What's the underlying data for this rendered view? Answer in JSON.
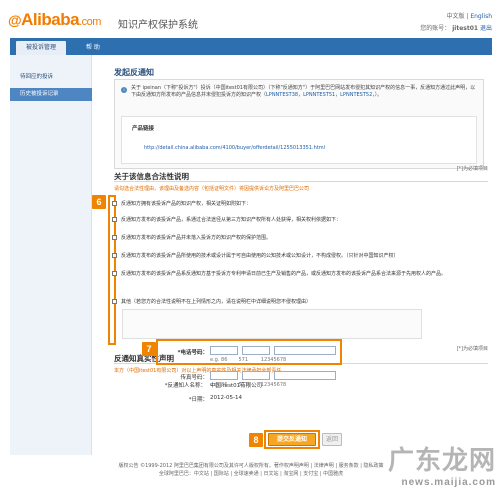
{
  "header": {
    "logo_text": "Alibaba",
    "logo_domain": ".com",
    "system_title": "知识产权保护系统",
    "lang_cn": "中文版",
    "lang_sep": "|",
    "lang_en": "English",
    "account_label": "您的账号：",
    "account_value": "jitest01",
    "logout": "退出"
  },
  "nav": {
    "tab_active": "被投诉管理",
    "tab_help": "帮 助"
  },
  "sidebar": {
    "items": [
      {
        "label": "待回应的投诉"
      },
      {
        "label": "历史被投诉记录"
      }
    ]
  },
  "page": {
    "title": "发起反通知",
    "notice_text": "关于 ipeinan（下称\"投诉方\"）投诉（中国itest01有限公司）（下称\"反通知方\"）于阿里巴巴网站发布侵犯其知识产权的信息一事，反通知方通过此声明，以下由反通知方所发布的产品信息并未侵犯投诉方的知识产权（",
    "notice_links": "LPNNTEST38，LPNNTEST51，LPNNTEST52，",
    "notice_end": "）。",
    "product_link_label": "产品链接",
    "product_link_url": "http://detail.china.alibaba.com/4100/buyer/offerdetail/1255013351.html",
    "required_note": "[*]为必填项目"
  },
  "legality": {
    "title": "关于该信息合法性说明",
    "hint": "请勾选合法性理由，该理由及备选内容（包括证明文件）将因提供诉讼方及阿里巴巴公司",
    "marker": "6",
    "intro": "反通知方拥有该投诉产品的知识产权，相关证明如附如下：",
    "options": [
      {
        "label": "反通知方发布的该投诉产品，系通过合法途径从第三方知识产权所有人处获得，相关权利依据如下："
      },
      {
        "label": "反通知方发布的该投诉产品并未落入投诉方的知识产权的保护范围。"
      },
      {
        "label": "反通知方发布的该投诉产品所使用的技术或设计属于可自由使用的公知技术或公知设计，不构成侵权。（只针对中国知识产权）"
      },
      {
        "label": "反通知方发布的该投诉产品系反通知方基于投诉方专利申请日前已生产及销售的产品，或反通知方发布的该投诉产品系合法来源于先用权人的产品。"
      },
      {
        "label": "其他（若您方的合法性说明不在上列情形之内，请在说明栏中详细说明您不侵权理由）"
      }
    ]
  },
  "declaration": {
    "title": "反通知真实性声明",
    "hint": "本方（中国itest01有限公司）对以上声明的真实性及相关法律承担全部责任",
    "signer_label": "*反通知人名称：",
    "signer_value": "中国itest01有限公司",
    "marker": "7",
    "phone_label": "*电话号码：",
    "phone_hint": "e.g. 86       571        12345678",
    "fax_label": "传真号码：",
    "fax_hint": "e.g. 86       571        12345678",
    "date_label": "*日期：",
    "date_value": "2012-05-14",
    "required_note": "[*]为必填项目"
  },
  "actions": {
    "marker": "8",
    "submit_label": "提交反通知",
    "back_label": "返回"
  },
  "footer": {
    "line1": "版权公告 ©1999-2012 阿里巴巴集团有限公司及其许可人版权所有。著作权声明声明 | 法律声明 | 服务条款 | 隐私政策",
    "line2": "全球阿里巴巴：中文站 | 国际站 | 全球速卖通 | 日文站 | 淘宝网 | 支付宝 | 中国雅虎"
  },
  "watermark": {
    "cn": "广东龙网",
    "en": "news.maijia.com"
  },
  "colors": {
    "brand_orange": "#f27c00",
    "nav_blue": "#2e6fb0",
    "marker_orange": "#f08300",
    "link_blue": "#1e5ca8"
  }
}
